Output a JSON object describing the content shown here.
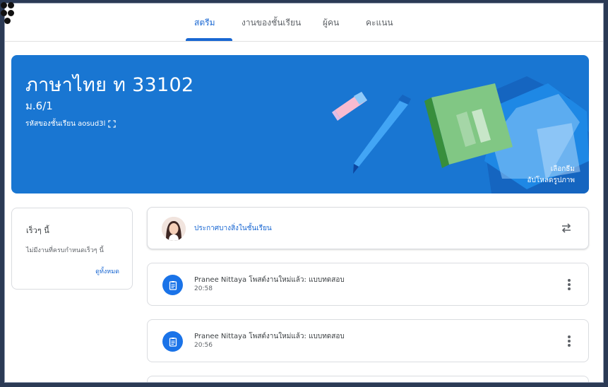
{
  "nav": {
    "tabs": [
      {
        "label": "สตรีม",
        "active": true
      },
      {
        "label": "งานของชั้นเรียน",
        "active": false
      },
      {
        "label": "ผู้คน",
        "active": false
      },
      {
        "label": "คะแนน",
        "active": false
      }
    ]
  },
  "banner": {
    "title": "ภาษาไทย ท 33102",
    "section": "ม.6/1",
    "class_code": "รหัสของชั้นเรียน aosud3l",
    "select_theme": "เลือกธีม",
    "upload_photo": "อัปโหลดรูปภาพ",
    "color": "#1976d2"
  },
  "upcoming": {
    "title": "เร็วๆ นี้",
    "empty_text": "ไม่มีงานที่ครบกำหนดเร็วๆ นี้",
    "view_all": "ดูทั้งหมด"
  },
  "announce": {
    "placeholder": "ประกาศบางสิ่งในชั้นเรียน"
  },
  "posts": [
    {
      "title": "Pranee Nittaya โพสต์งานใหม่แล้ว: แบบทดสอบ",
      "time": "20:58",
      "icon": "assignment-icon"
    },
    {
      "title": "Pranee Nittaya โพสต์งานใหม่แล้ว: แบบทดสอบ",
      "time": "20:56",
      "icon": "assignment-icon"
    }
  ],
  "colors": {
    "accent": "#1967d2",
    "frame": "#2b3a55"
  }
}
